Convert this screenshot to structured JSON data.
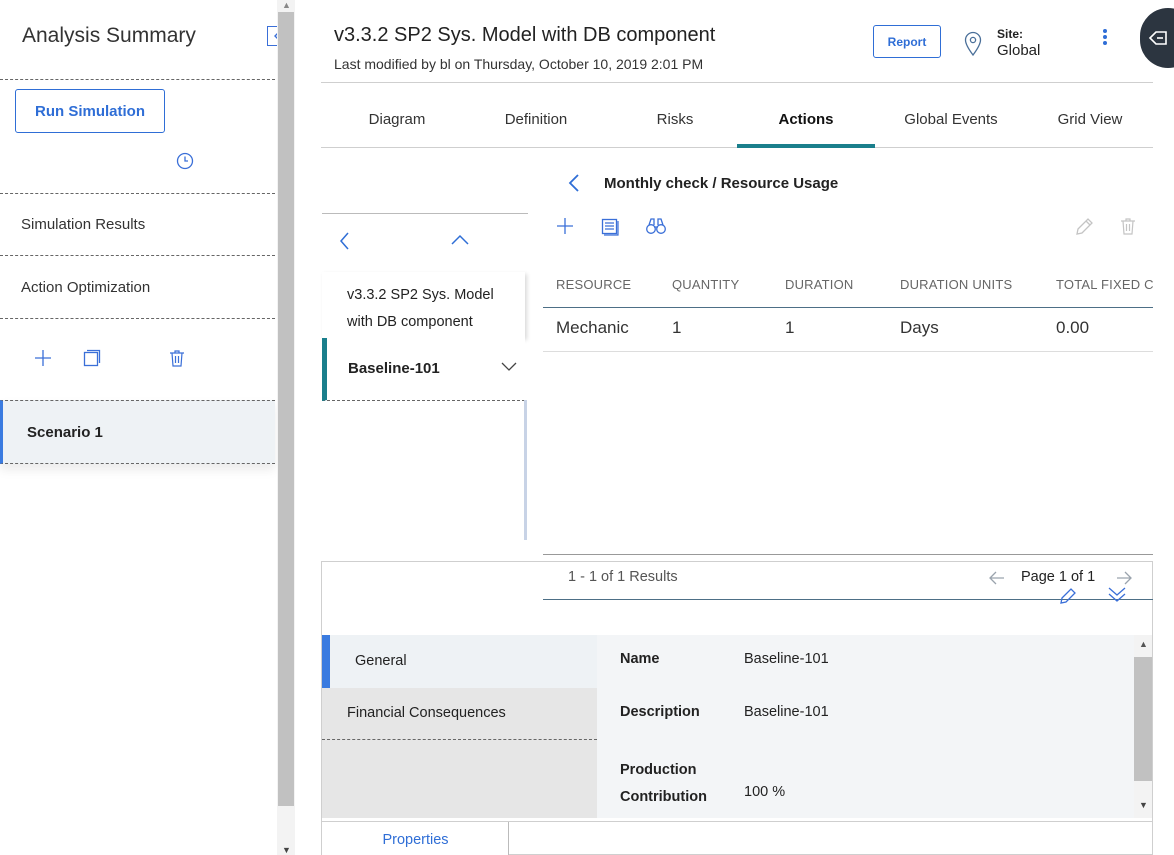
{
  "left_panel": {
    "title": "Analysis Summary",
    "run_button": "Run Simulation",
    "items": [
      {
        "label": "Simulation Results"
      },
      {
        "label": "Action Optimization"
      }
    ],
    "scenario": "Scenario 1"
  },
  "header": {
    "title": "v3.3.2 SP2 Sys. Model with DB component",
    "subtitle": "Last modified by bl on Thursday, October 10, 2019 2:01 PM",
    "report_button": "Report",
    "site_label": "Site:",
    "site_value": "Global"
  },
  "tabs": [
    {
      "label": "Diagram"
    },
    {
      "label": "Definition"
    },
    {
      "label": "Risks"
    },
    {
      "label": "Actions"
    },
    {
      "label": "Global Events"
    },
    {
      "label": "Grid View"
    }
  ],
  "active_tab": "Actions",
  "breadcrumb": "Monthly check / Resource Usage",
  "tree": {
    "parent": "v3.3.2 SP2 Sys. Model with DB component",
    "selected": "Baseline-101"
  },
  "grid": {
    "columns": [
      "RESOURCE",
      "QUANTITY",
      "DURATION",
      "DURATION UNITS",
      "TOTAL FIXED CO"
    ],
    "rows": [
      [
        "Mechanic",
        "1",
        "1",
        "Days",
        "0.00"
      ]
    ],
    "results": "1 - 1 of 1 Results",
    "page": "Page 1 of 1"
  },
  "details": {
    "sections": [
      {
        "label": "General"
      },
      {
        "label": "Financial Consequences"
      }
    ],
    "fields": [
      {
        "label": "Name",
        "value": "Baseline-101"
      },
      {
        "label": "Description",
        "value": "Baseline-101"
      },
      {
        "label": "Production Contribution",
        "label_line1": "Production",
        "label_line2": "Contribution",
        "value": "100 %"
      }
    ],
    "bottom_tab": "Properties"
  },
  "colors": {
    "accent": "#2f6ed6",
    "tab_indicator": "#1a7f8c",
    "selected_bar": "#1a7f8c",
    "general_bar": "#3a7be0"
  },
  "icons": [
    "collapse-panel-icon",
    "history-clock-icon",
    "add-icon",
    "copy-icon",
    "trash-icon",
    "location-pin-icon",
    "kebab-menu-icon",
    "exit-icon",
    "back-chevron-icon",
    "up-chevron-icon",
    "down-chevron-icon",
    "report-sheet-icon",
    "binoculars-icon",
    "edit-pencil-icon",
    "arrow-left-icon",
    "arrow-right-icon",
    "double-chevron-down-icon"
  ]
}
